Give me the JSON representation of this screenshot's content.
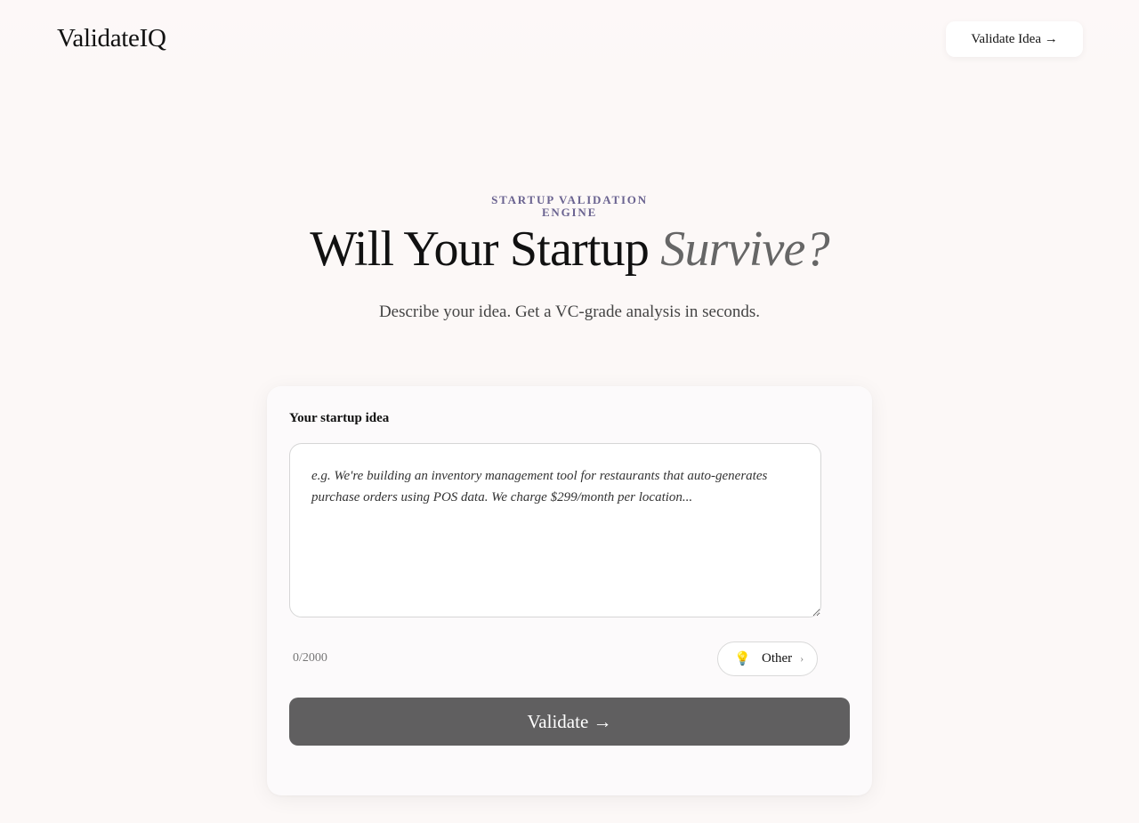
{
  "header": {
    "logo": "ValidateIQ",
    "cta_label": "Validate Idea →"
  },
  "hero": {
    "eyebrow": "STARTUP VALIDATION ENGINE",
    "headline_main": "Will Your Startup ",
    "headline_accent": "Survive?",
    "subheadline": "Describe your idea. Get a VC-grade analysis in seconds."
  },
  "form": {
    "label": "Your startup idea",
    "value": "",
    "placeholder": "e.g. We're building an inventory management tool for restaurants that auto-generates purchase orders using POS data. We charge $299/month per location...",
    "char_count": "0/2000",
    "category": {
      "icon": "lightbulb-icon",
      "glyph": "💡",
      "label": "Other",
      "chevron": "›"
    },
    "submit_label": "Validate →"
  },
  "colors": {
    "background": "#fcf8f7",
    "eyebrow": "#6a6390",
    "accent_text": "#666666",
    "button": "#605f60"
  }
}
